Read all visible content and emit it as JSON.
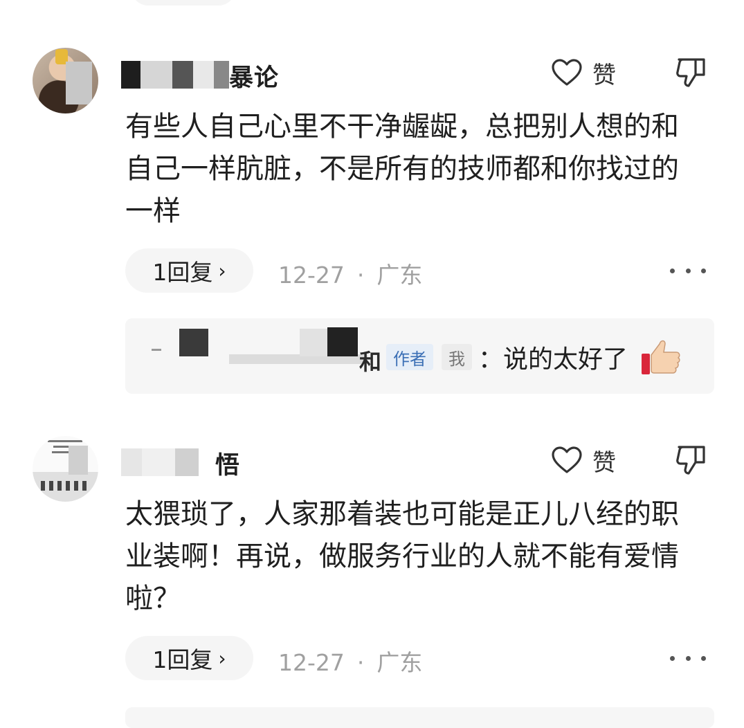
{
  "comments": [
    {
      "username_visible": "暴论",
      "like_label": "赞",
      "text": "有些人自己心里不干净龌龊，总把别人想的和自己一样肮脏，不是所有的技师都和你找过的一样",
      "reply_button": "1回复",
      "date": "12-27",
      "location": "广东",
      "sub_reply": {
        "username_visible": "和",
        "author_badge": "作者",
        "me_badge": "我",
        "text": "：说的太好了",
        "emoji_icon": "thumbs-up-icon"
      }
    },
    {
      "username_visible": "悟",
      "like_label": "赞",
      "text": "太猥琐了，人家那着装也可能是正儿八经的职业装啊！再说，做服务行业的人就不能有爱情啦？",
      "reply_button": "1回复",
      "date": "12-27",
      "location": "广东"
    }
  ],
  "meta_separator": "·",
  "chevron": "›",
  "colors": {
    "meta_gray": "#a0a0a0",
    "badge_blue": "#3b6fb5",
    "pill_bg": "#f5f5f5"
  }
}
